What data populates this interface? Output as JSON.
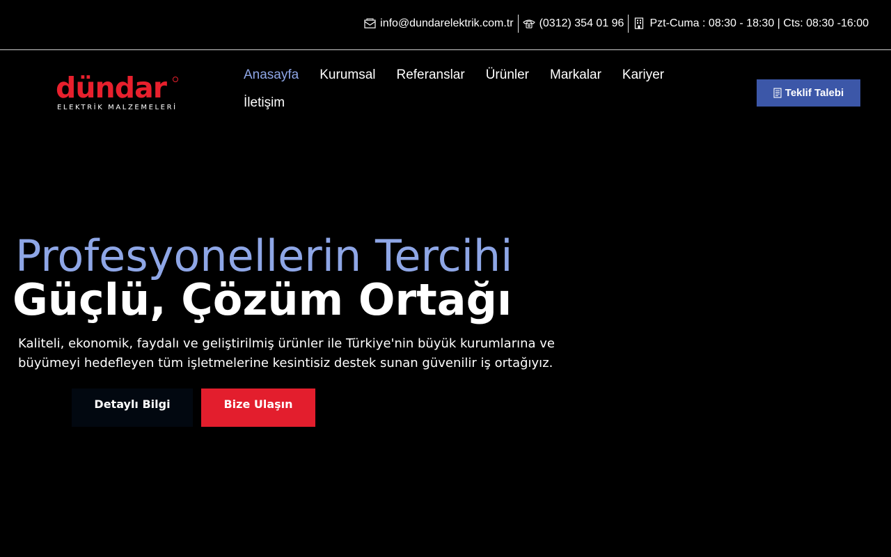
{
  "topbar": {
    "email": "info@dundarelektrik.com.tr",
    "phone": "(0312) 354 01 96",
    "hours": "Pzt-Cuma : 08:30 - 18:30 | Cts: 08:30 -16:00",
    "icons": [
      "envelope-icon",
      "phone-icon",
      "building-icon"
    ]
  },
  "logo": {
    "word": "dündar",
    "subtitle": "ELEKTRİK MALZEMELERİ"
  },
  "nav": {
    "items": [
      {
        "label": "Anasayfa",
        "active": true
      },
      {
        "label": "Kurumsal",
        "active": false
      },
      {
        "label": "Referanslar",
        "active": false
      },
      {
        "label": "Ürünler",
        "active": false
      },
      {
        "label": "Markalar",
        "active": false
      },
      {
        "label": "Kariyer",
        "active": false
      },
      {
        "label": "İletişim",
        "active": false
      }
    ]
  },
  "header_button": {
    "label": "Teklif Talebi",
    "icon": "document-icon"
  },
  "hero": {
    "subtitle": "Profesyonellerin Tercihi",
    "title": "Güçlü, Çözüm Ortağı",
    "text": "Kaliteli, ekonomik, faydalı ve geliştirilmiş ürünler ile Türkiye'nin büyük kurumlarına ve büyümeyi hedefleyen tüm işletmelerine kesintisiz destek sunan güvenilir iş ortağıyız.",
    "button_detail": "Detaylı Bilgi",
    "button_contact": "Bize Ulaşın"
  },
  "colors": {
    "background": "#000000",
    "accent_blue": "#8ea6e6",
    "brand_red": "#e8202d",
    "button_blue": "#3c57a8"
  }
}
